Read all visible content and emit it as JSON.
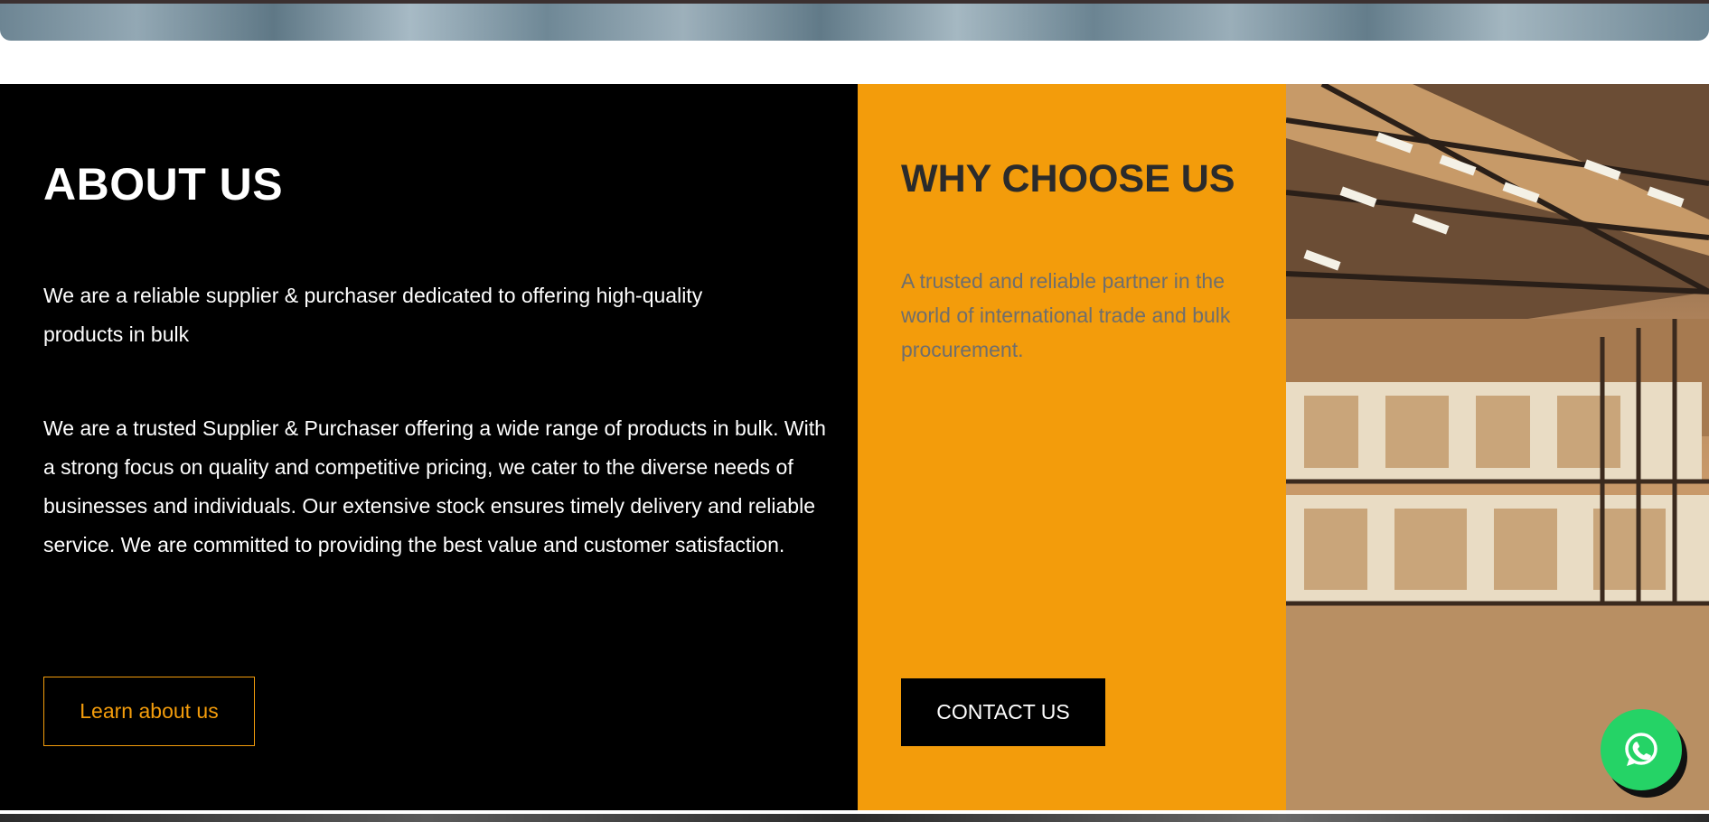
{
  "about": {
    "title": "ABOUT US",
    "paragraph_1": "We are a reliable supplier & purchaser dedicated to offering high-quality products in bulk",
    "paragraph_2": "We are a trusted Supplier & Purchaser offering a wide range of products in bulk. With a strong focus on quality and competitive pricing, we cater to the diverse needs of businesses and individuals. Our extensive stock ensures timely delivery and reliable service. We are committed to providing the best value and customer satisfaction.",
    "button_label": "Learn about us"
  },
  "why": {
    "title": "WHY CHOOSE US",
    "text": "A trusted and reliable partner in the world of international trade and bulk procurement.",
    "button_label": "CONTACT US"
  },
  "images": {
    "warehouse": "warehouse-photo",
    "hero": "hero-banner-photo"
  },
  "floating": {
    "icon": "whatsapp-icon"
  },
  "colors": {
    "accent": "#f39c0b",
    "dark": "#000000",
    "whatsapp": "#25d366"
  }
}
